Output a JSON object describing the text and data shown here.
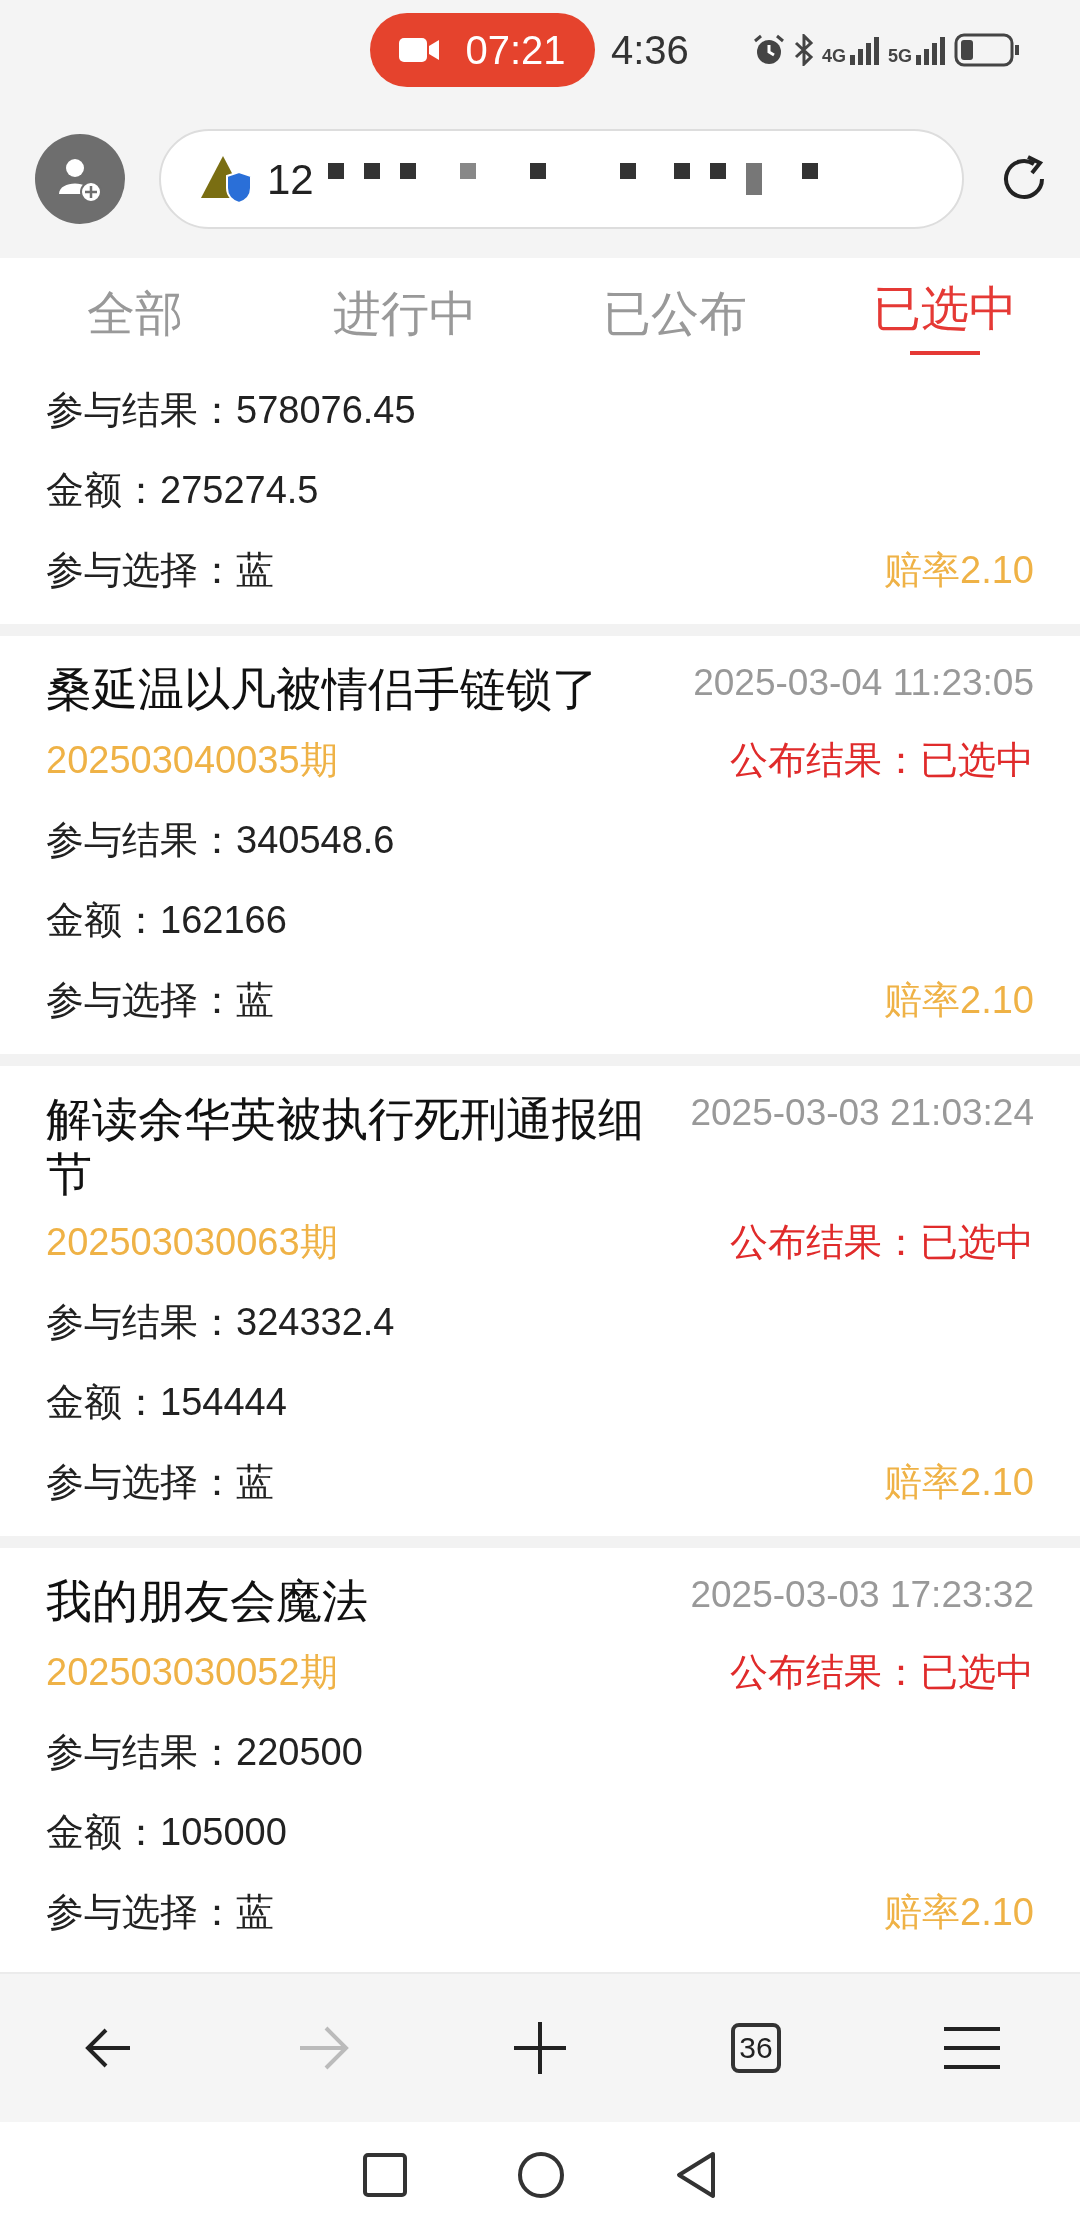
{
  "status_bar": {
    "recording_time": "07:21",
    "clock": "4:36",
    "networks": [
      "4G",
      "5G"
    ]
  },
  "address_bar": {
    "url": "12"
  },
  "tabs": [
    {
      "label": "全部",
      "selected": false
    },
    {
      "label": "进行中",
      "selected": false
    },
    {
      "label": "已公布",
      "selected": false
    },
    {
      "label": "已选中",
      "selected": true
    }
  ],
  "records": [
    {
      "result": "参与结果：578076.45",
      "amount": "金额：275274.5",
      "choice": "参与选择：蓝",
      "odds": "赔率2.10"
    },
    {
      "title": "桑延温以凡被情侣手链锁了",
      "time": "2025-03-04 11:23:05",
      "period": "202503040035期",
      "published": "公布结果：已选中",
      "result": "参与结果：340548.6",
      "amount": "金额：162166",
      "choice": "参与选择：蓝",
      "odds": "赔率2.10"
    },
    {
      "title": "解读余华英被执行死刑通报细节",
      "time": "2025-03-03 21:03:24",
      "period": "202503030063期",
      "published": "公布结果：已选中",
      "result": "参与结果：324332.4",
      "amount": "金额：154444",
      "choice": "参与选择：蓝",
      "odds": "赔率2.10"
    },
    {
      "title": "我的朋友会魔法",
      "time": "2025-03-03 17:23:32",
      "period": "202503030052期",
      "published": "公布结果：已选中",
      "result": "参与结果：220500",
      "amount": "金额：105000",
      "choice": "参与选择：蓝",
      "odds": "赔率2.10"
    }
  ],
  "toolbar": {
    "forward_disabled": true,
    "tab_count": "36"
  }
}
